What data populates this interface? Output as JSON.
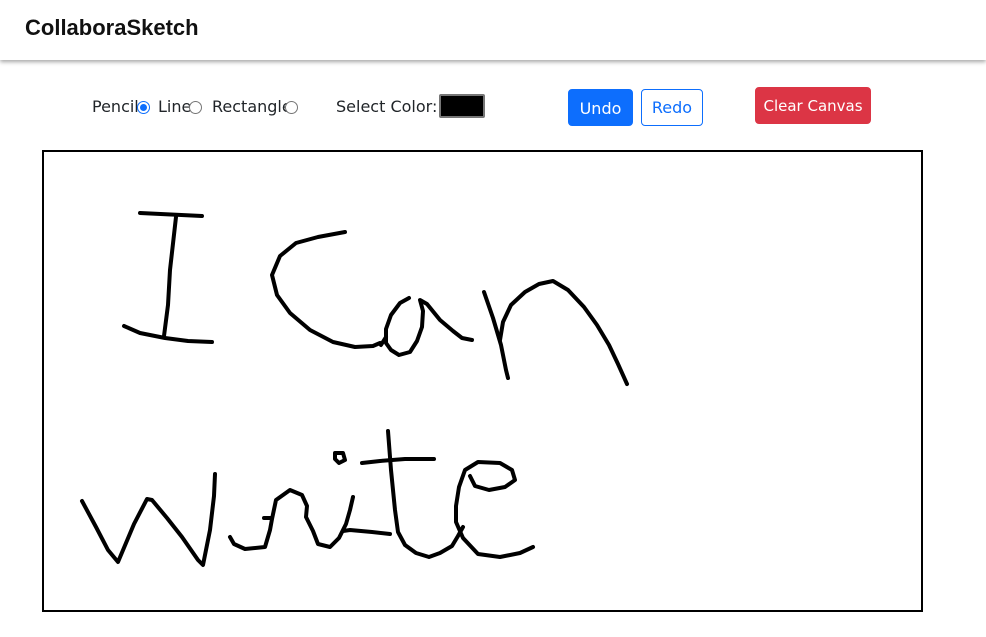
{
  "app": {
    "brand": "CollaboraSketch"
  },
  "toolbar": {
    "tools": [
      {
        "label": "Pencil",
        "checked": true
      },
      {
        "label": "Line",
        "checked": false
      },
      {
        "label": "Rectangle",
        "checked": false
      }
    ],
    "color_label": "Select Color:",
    "color_value": "#000000",
    "undo_label": "Undo",
    "redo_label": "Redo",
    "clear_label": "Clear Canvas"
  },
  "colors": {
    "primary": "#0d6efd",
    "danger": "#dc3545",
    "stroke": "#000000"
  }
}
